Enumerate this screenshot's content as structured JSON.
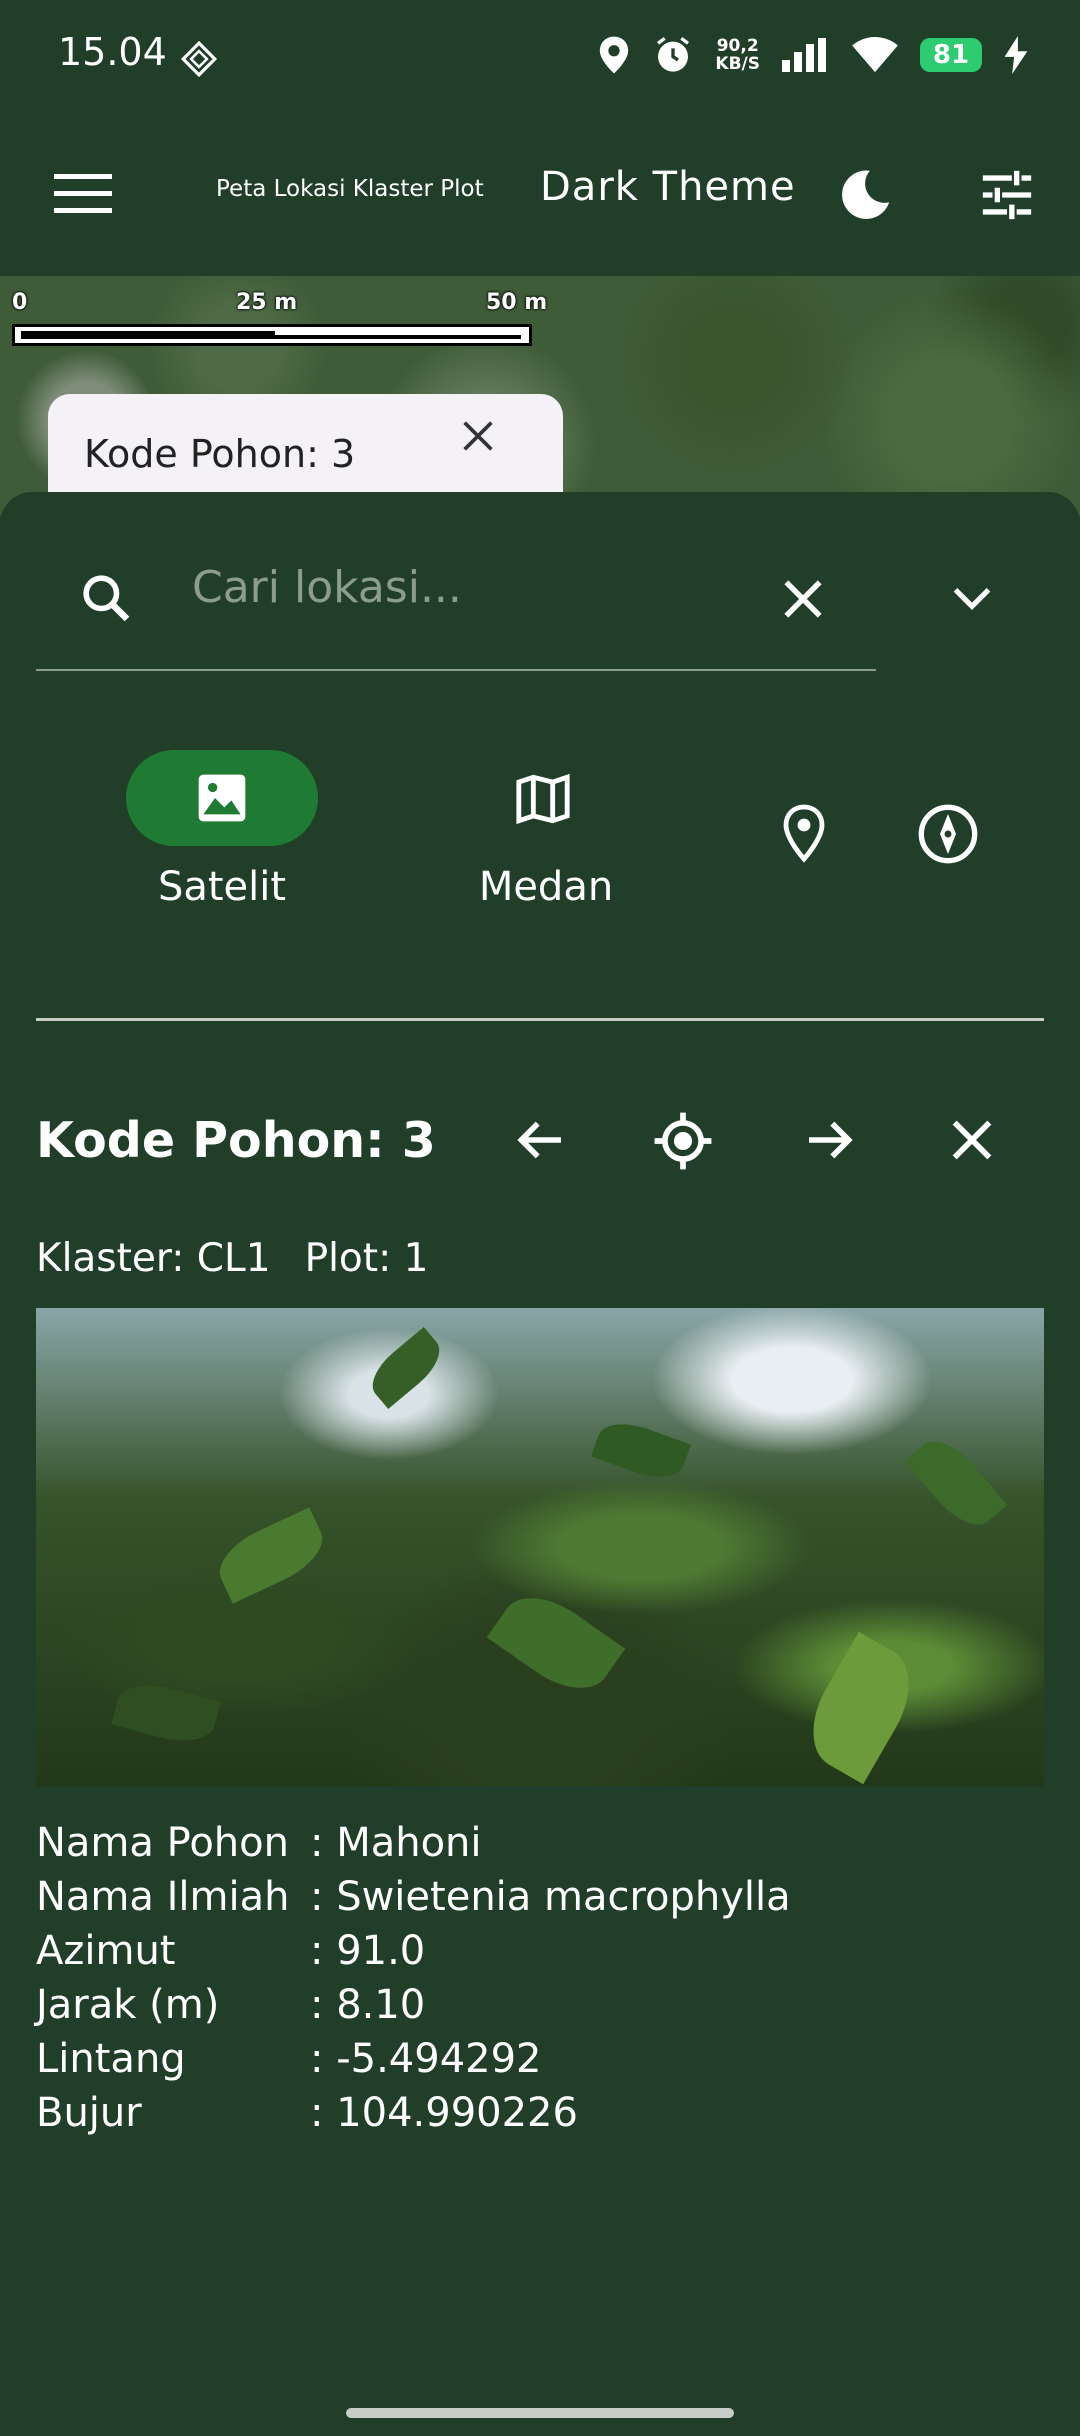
{
  "status_bar": {
    "time": "15.04",
    "net_speed_value": "90,2",
    "net_speed_unit": "KB/S",
    "battery": "81",
    "icons": [
      "android-debug-icon",
      "location-icon",
      "alarm-icon",
      "signal-icon",
      "wifi-icon",
      "battery-icon",
      "charging-icon"
    ]
  },
  "app_bar": {
    "title": "Peta Lokasi Klaster Plot",
    "theme_label": "Dark Theme",
    "icons": [
      "menu-icon",
      "moon-icon",
      "filter-icon"
    ]
  },
  "map": {
    "scale_labels": [
      "0",
      "25 m",
      "50 m"
    ],
    "marker_label": "Kode Pohon: 3"
  },
  "search": {
    "placeholder": "Cari lokasi..."
  },
  "map_modes": {
    "buttons": [
      {
        "label": "Satelit",
        "icon": "image-icon",
        "active": true
      },
      {
        "label": "Medan",
        "icon": "map-icon",
        "active": false
      }
    ],
    "extra_icons": [
      "location-pin-icon",
      "compass-icon"
    ]
  },
  "tree": {
    "title": "Kode Pohon: 3",
    "klaster": "Klaster: CL1",
    "plot": "Plot: 1",
    "details": [
      {
        "key": "Nama Pohon",
        "value": ": Mahoni"
      },
      {
        "key": "Nama Ilmiah",
        "value": ": Swietenia macrophylla"
      },
      {
        "key": "Azimut",
        "value": ": 91.0"
      },
      {
        "key": "Jarak (m)",
        "value": ": 8.10"
      },
      {
        "key": "Lintang",
        "value": ": -5.494292"
      },
      {
        "key": "Bujur",
        "value": ": 104.990226"
      }
    ]
  },
  "colors": {
    "background": "#213f28",
    "active_pill": "#1f7a34",
    "battery": "#2ecc71"
  }
}
